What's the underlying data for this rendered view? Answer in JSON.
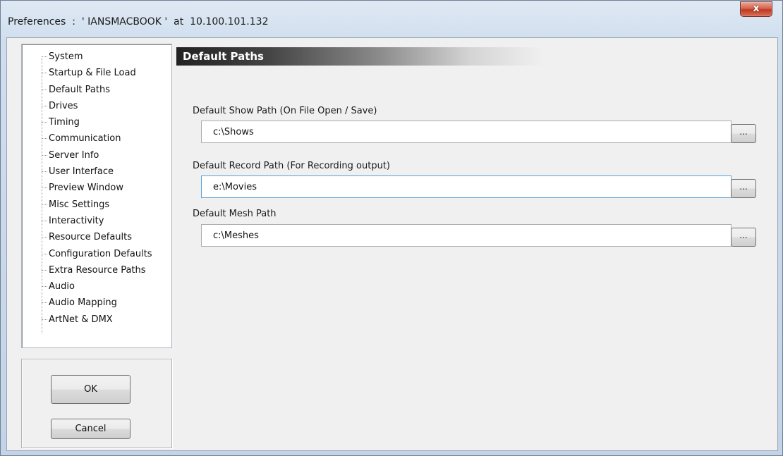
{
  "window": {
    "title": "Preferences  :  ' IANSMACBOOK '  at  10.100.101.132",
    "close_label": "x"
  },
  "sidebar": {
    "items": [
      {
        "label": "System"
      },
      {
        "label": "Startup & File Load"
      },
      {
        "label": "Default Paths"
      },
      {
        "label": "Drives"
      },
      {
        "label": "Timing"
      },
      {
        "label": "Communication"
      },
      {
        "label": "Server Info"
      },
      {
        "label": "User Interface"
      },
      {
        "label": "Preview Window"
      },
      {
        "label": "Misc Settings"
      },
      {
        "label": "Interactivity"
      },
      {
        "label": "Resource Defaults"
      },
      {
        "label": "Configuration Defaults"
      },
      {
        "label": "Extra Resource Paths"
      },
      {
        "label": "Audio"
      },
      {
        "label": "Audio Mapping"
      },
      {
        "label": "ArtNet & DMX"
      }
    ]
  },
  "buttons": {
    "ok_label": "OK",
    "cancel_label": "Cancel"
  },
  "main": {
    "section_title": "Default Paths",
    "paths": [
      {
        "label": "Default Show Path (On File Open / Save)",
        "value": "c:\\Shows",
        "browse_label": "..."
      },
      {
        "label": "Default Record Path (For Recording output)",
        "value": "e:\\Movies",
        "browse_label": "..."
      },
      {
        "label": "Default Mesh Path",
        "value": "c:\\Meshes",
        "browse_label": "..."
      }
    ]
  }
}
